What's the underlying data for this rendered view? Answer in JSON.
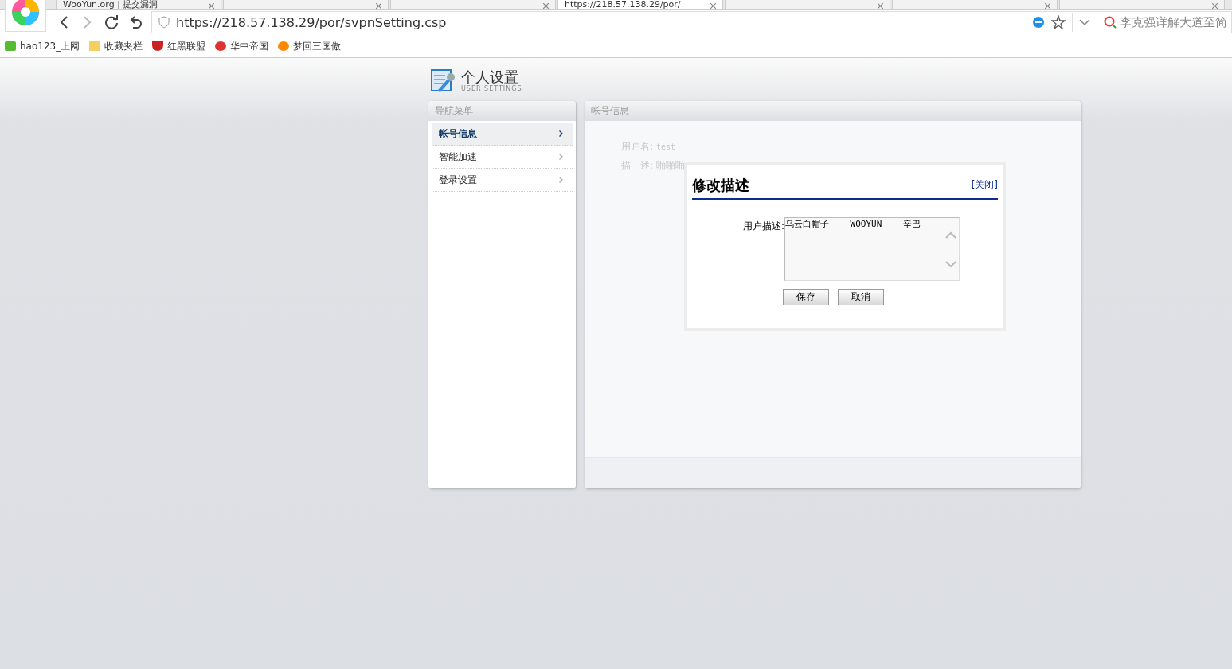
{
  "browser": {
    "tabs": [
      {
        "title": "WooYun.org | 提交漏洞",
        "selected": false
      },
      {
        "selected": false
      },
      {
        "selected": false
      },
      {
        "title": "https://218.57.138.29/por/",
        "selected": true
      },
      {
        "selected": false
      },
      {
        "selected": false
      },
      {
        "selected": false
      }
    ],
    "address": "https://218.57.138.29/por/svpnSetting.csp",
    "search_placeholder": "李克强详解大道至简",
    "bookmarks": [
      "hao123_上网",
      "收藏夹栏",
      "红黑联盟",
      "华中帝国",
      "梦回三国傲"
    ]
  },
  "header": {
    "title": "个人设置",
    "subtitle": "USER SETTINGS"
  },
  "nav": {
    "title": "导航菜单",
    "items": [
      {
        "label": "帐号信息",
        "selected": true
      },
      {
        "label": "智能加速",
        "selected": false
      },
      {
        "label": "登录设置",
        "selected": false
      }
    ]
  },
  "panel": {
    "title": "帐号信息",
    "username_label": "用户名:",
    "username": "test",
    "desc_label": "描　述:",
    "desc": "啪啪啪"
  },
  "dialog": {
    "title": "修改描述",
    "close": "[关闭]",
    "field_label": "用户描述:",
    "field_value": "乌云白帽子    WOOYUN    辛巴",
    "buttons": [
      "保存",
      "取消"
    ]
  }
}
